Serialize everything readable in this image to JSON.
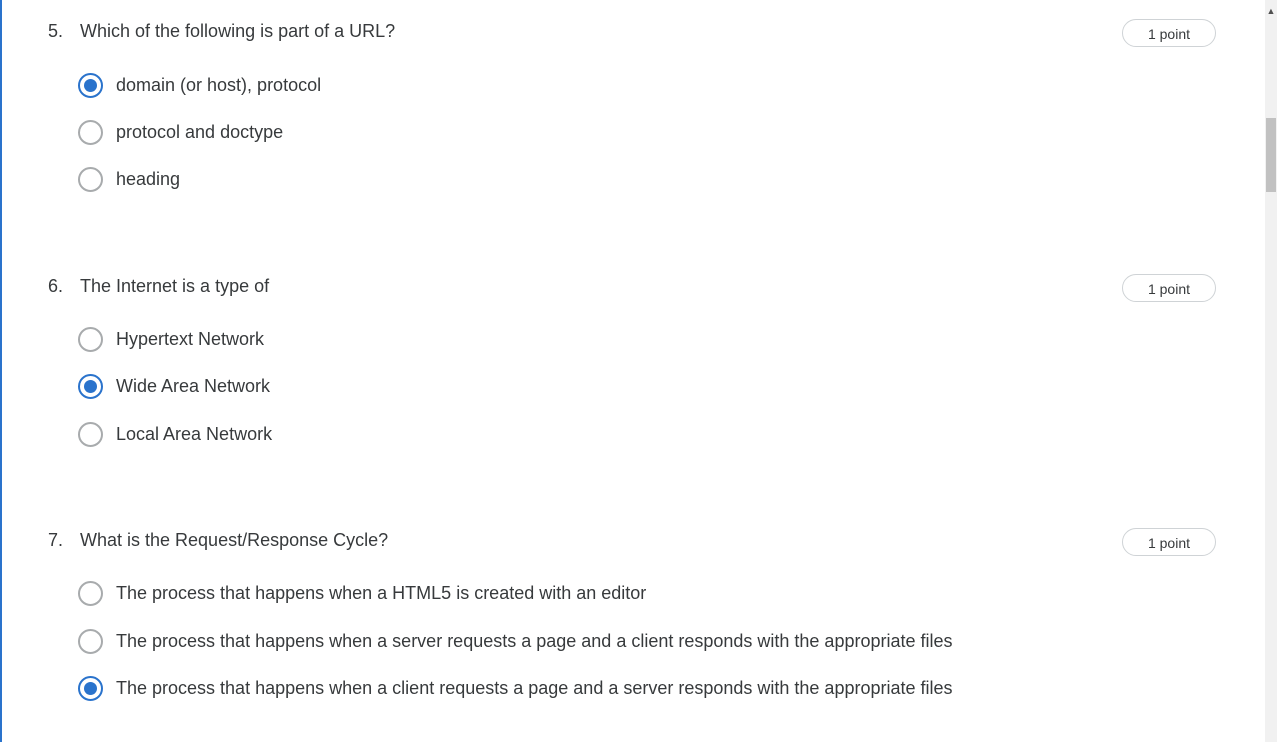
{
  "questions": [
    {
      "number": "5.",
      "text": "Which of the following is part of a URL?",
      "points": "1 point",
      "options": [
        {
          "label": "domain (or host), protocol",
          "selected": true
        },
        {
          "label": "protocol and doctype",
          "selected": false
        },
        {
          "label": "heading",
          "selected": false
        }
      ]
    },
    {
      "number": "6.",
      "text": "The Internet is a type of",
      "points": "1 point",
      "options": [
        {
          "label": "Hypertext Network",
          "selected": false
        },
        {
          "label": "Wide Area Network",
          "selected": true
        },
        {
          "label": "Local Area Network",
          "selected": false
        }
      ]
    },
    {
      "number": "7.",
      "text": "What is the Request/Response Cycle?",
      "points": "1 point",
      "options": [
        {
          "label": "The process that happens when a HTML5 is created with an editor",
          "selected": false
        },
        {
          "label": "The process that happens when a server requests a page and a client responds with the appropriate files",
          "selected": false
        },
        {
          "label": "The process that happens when a client requests a page and a server responds with the appropriate files",
          "selected": true
        }
      ]
    }
  ],
  "colors": {
    "accent": "#2a73cc",
    "text": "#373a3c",
    "radio_border": "#a8abad"
  },
  "icons": {
    "scroll_up": "scroll-up-arrow-icon"
  }
}
